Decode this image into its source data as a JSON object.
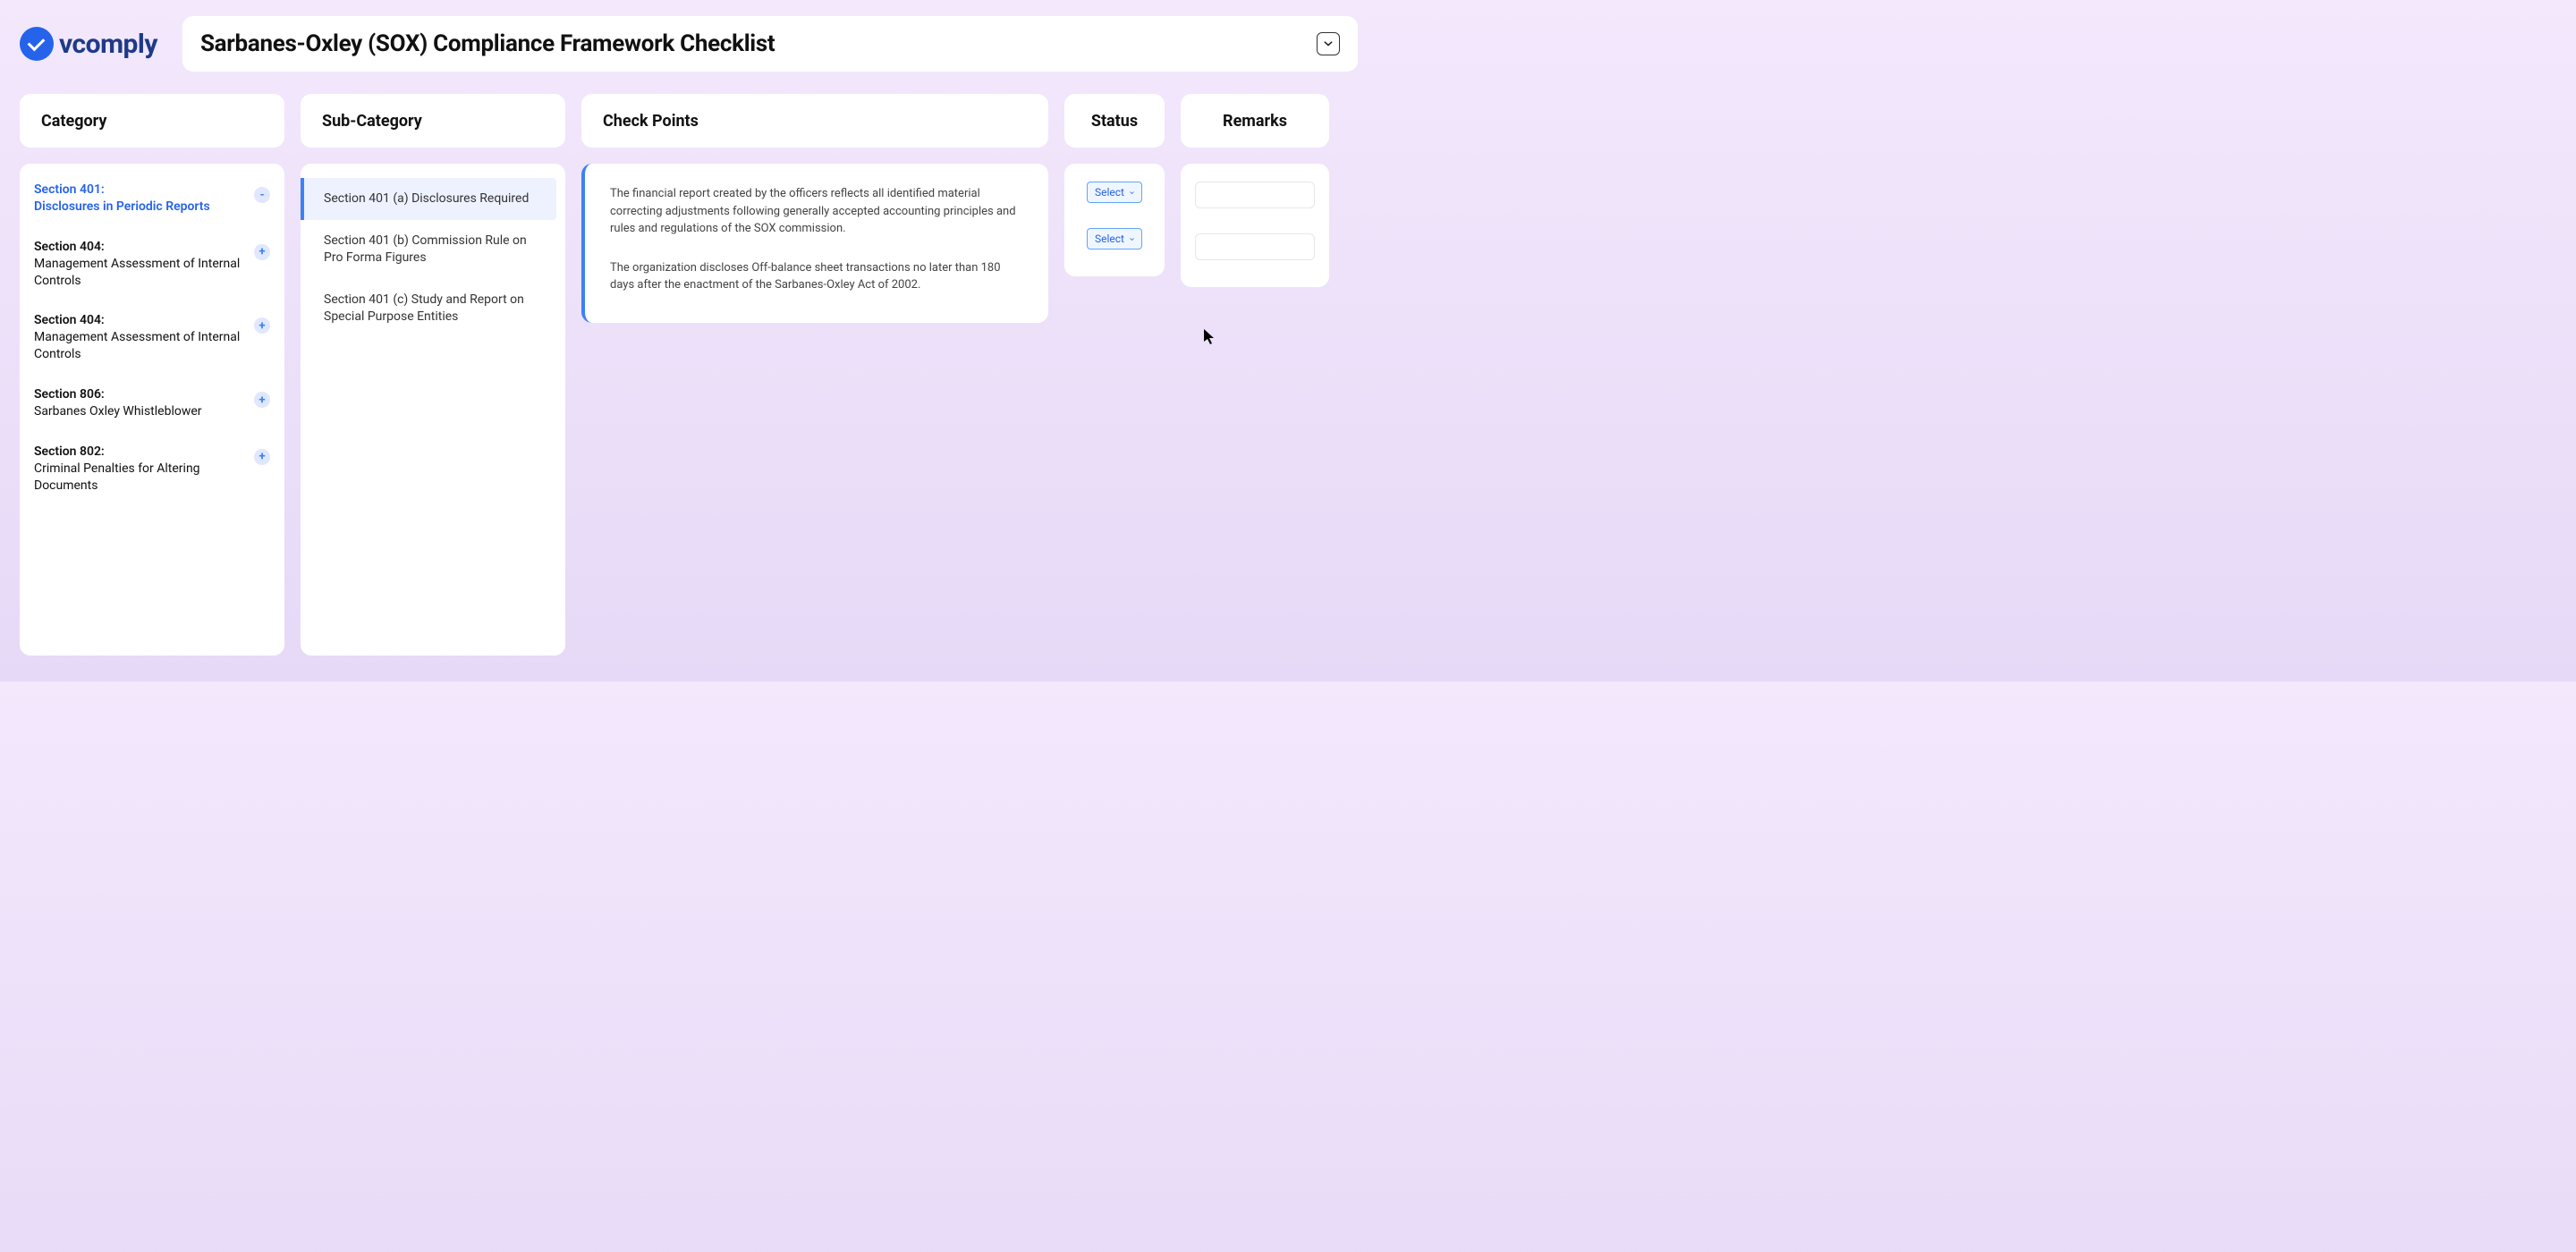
{
  "brand": {
    "name": "vcomply"
  },
  "title": "Sarbanes-Oxley (SOX) Compliance Framework Checklist",
  "headers": {
    "category": "Category",
    "sub_category": "Sub-Category",
    "check_points": "Check Points",
    "status": "Status",
    "remarks": "Remarks"
  },
  "categories": [
    {
      "section": "Section 401:",
      "desc": "Disclosures in Periodic Reports",
      "active": true,
      "icon": "-"
    },
    {
      "section": "Section 404:",
      "desc": "Management Assessment of Internal Controls",
      "active": false,
      "icon": "+"
    },
    {
      "section": "Section 404:",
      "desc": "Management Assessment of Internal Controls",
      "active": false,
      "icon": "+"
    },
    {
      "section": "Section 806:",
      "desc": "Sarbanes Oxley Whistleblower",
      "active": false,
      "icon": "+"
    },
    {
      "section": "Section 802:",
      "desc": "Criminal Penalties for Altering Documents",
      "active": false,
      "icon": "+"
    }
  ],
  "sub_categories": [
    {
      "label": "Section 401 (a) Disclosures Required",
      "active": true
    },
    {
      "label": "Section 401 (b) Commission Rule on Pro Forma Figures",
      "active": false
    },
    {
      "label": "Section 401 (c) Study and Report on Special Purpose Entities",
      "active": false
    }
  ],
  "check_points": [
    "The financial report created by the officers reflects all identified material correcting adjustments following generally accepted accounting principles and rules and regulations of the SOX commission.",
    "The organization discloses Off-balance sheet transactions no later than 180 days after the enactment of the Sarbanes-Oxley Act of 2002."
  ],
  "status": {
    "select_label": "Select"
  }
}
